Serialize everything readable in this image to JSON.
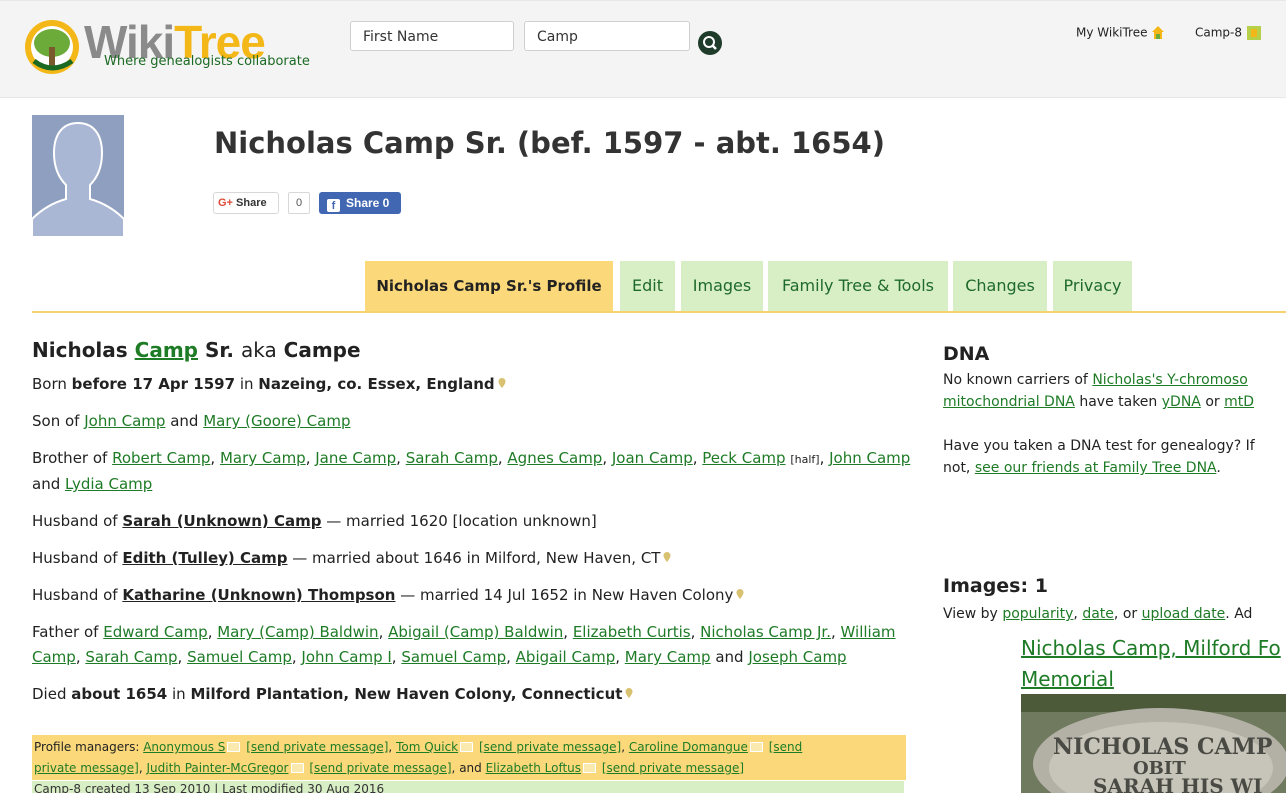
{
  "header": {
    "logo_wiki": "Wiki",
    "logo_tree": "Tree",
    "tagline": "Where genealogists collaborate",
    "first_name_value": "First Name",
    "last_name_value": "Camp",
    "nav_my_wikitree": "My WikiTree",
    "nav_user": "Camp-8"
  },
  "profile": {
    "title": "Nicholas Camp Sr. (bef. 1597 - abt. 1654)",
    "share": {
      "google_label": "Share",
      "google_count": "0",
      "facebook_label": "Share 0"
    }
  },
  "tabs": [
    {
      "label": "Nicholas Camp Sr.'s Profile"
    },
    {
      "label": "Edit"
    },
    {
      "label": "Images"
    },
    {
      "label": "Family Tree & Tools"
    },
    {
      "label": "Changes"
    },
    {
      "label": "Privacy"
    }
  ],
  "main": {
    "name_first": "Nicholas",
    "name_last": "Camp",
    "name_suffix": "Sr.",
    "aka": "aka",
    "aka_name": "Campe",
    "born_prefix": "Born",
    "born_date": "before 17 Apr 1597",
    "born_in": "in",
    "born_place": "Nazeing, co. Essex, England",
    "son_of": "Son of",
    "father": "John Camp",
    "and": "and",
    "mother": "Mary (Goore) Camp",
    "brother_of": "Brother of",
    "siblings": [
      "Robert Camp",
      "Mary Camp",
      "Jane Camp",
      "Sarah Camp",
      "Agnes Camp",
      "Joan Camp",
      "Peck Camp",
      "John Camp",
      "Lydia Camp"
    ],
    "half_tag": "[half]",
    "husband_of": "Husband of",
    "spouse1": "Sarah (Unknown) Camp",
    "spouse1_detail": "— married 1620 [location unknown]",
    "spouse2": "Edith (Tulley) Camp",
    "spouse2_detail": "— married about 1646 in Milford, New Haven, CT",
    "spouse3": "Katharine (Unknown) Thompson",
    "spouse3_detail": "— married 14 Jul 1652 in New Haven Colony",
    "father_of": "Father of",
    "children": [
      "Edward Camp",
      "Mary (Camp) Baldwin",
      "Abigail (Camp) Baldwin",
      "Elizabeth Curtis",
      "Nicholas Camp Jr.",
      "William Camp",
      "Sarah Camp",
      "Samuel Camp",
      "John Camp I",
      "Samuel Camp",
      "Abigail Camp",
      "Mary Camp",
      "Joseph Camp"
    ],
    "died_prefix": "Died",
    "died_date": "about 1654",
    "died_place": "Milford Plantation, New Haven Colony, Connecticut"
  },
  "managers": {
    "prefix": "Profile managers:",
    "send_msg": "[send private message]",
    "names": [
      "Anonymous S",
      "Tom Quick",
      "Caroline Domangue",
      "Judith Painter-McGregor",
      "Elizabeth Loftus"
    ],
    "and": "and",
    "send_msg_1": "[send",
    "send_msg_2": "private message]"
  },
  "created_line": "Camp-8 created 13 Sep 2010 | Last modified 30 Aug 2016",
  "dna": {
    "heading": "DNA",
    "line1_prefix": "No known carriers of",
    "line1_link": "Nicholas's Y-chromoso",
    "line2_link1": "mitochondrial DNA",
    "line2_mid": "have taken",
    "line2_link2": "yDNA",
    "line2_or": "or",
    "line2_link3": "mtD",
    "line3": "Have you taken a DNA test for genealogy? If",
    "line4_prefix": "not,",
    "line4_link": "see our friends at Family Tree DNA",
    "line4_suffix": "."
  },
  "images": {
    "heading": "Images: 1",
    "view_by": "View by",
    "popularity": "popularity",
    "date": "date",
    "or": "or",
    "upload_date": "upload date",
    "ad": ". Ad",
    "caption_line1": "Nicholas Camp, Milford Fo",
    "caption_line2": "Memorial",
    "engraving_line1": "NICHOLAS  CAMP",
    "engraving_line2": "OBIT",
    "engraving_line3": "SARAH HIS WI"
  },
  "colors": {
    "accent_green": "#1e7b26",
    "tab_green": "#d8eec5",
    "tab_yellow": "#fbd97a",
    "logo_yellow": "#f3b717"
  }
}
